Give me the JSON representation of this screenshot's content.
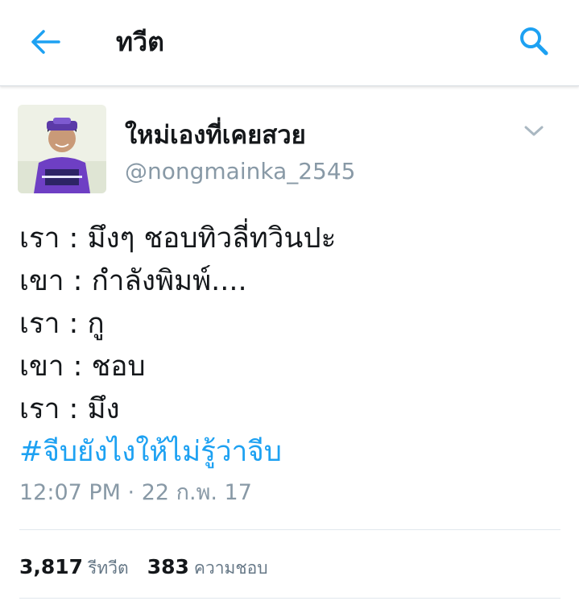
{
  "header": {
    "title": "ทวีต",
    "back_icon": "arrow-left-icon",
    "search_icon": "search-icon"
  },
  "colors": {
    "accent": "#1da1f2",
    "secondary_text": "#8899a6",
    "primary_text": "#14171a"
  },
  "tweet": {
    "author": {
      "display_name": "ใหม่เองที่เคยสวย",
      "handle": "@nongmainka_2545"
    },
    "lines": [
      "เรา : มึงๆ ชอบทิวลี่ทวินปะ",
      "เขา : กำลังพิมพ์....",
      "เรา : กู",
      "เขา : ชอบ",
      "เรา : มึง"
    ],
    "hashtag": "#จีบยังไงให้ไม่รู้ว่าจีบ",
    "timestamp": "12:07 PM · 22 ก.พ. 17",
    "stats": {
      "retweets_count": "3,817",
      "retweets_label": "รีทวีต",
      "likes_count": "383",
      "likes_label": "ความชอบ"
    }
  }
}
